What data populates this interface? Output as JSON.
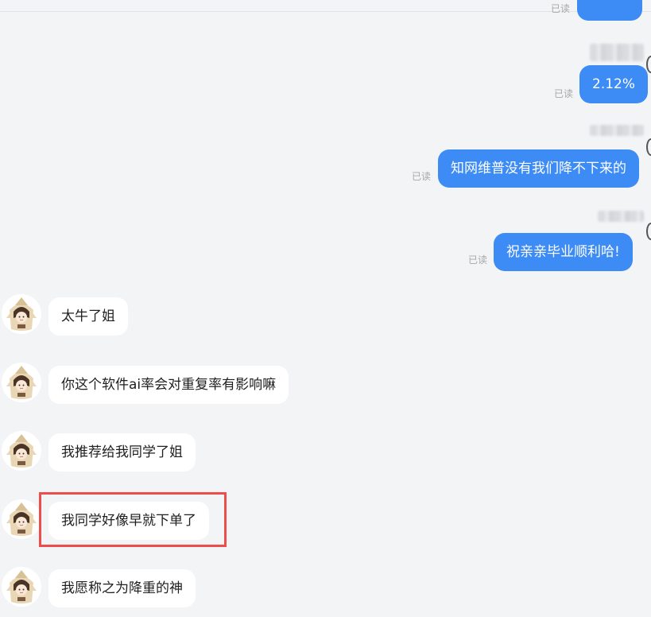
{
  "conversation": {
    "read_label": "已读",
    "outgoing": [
      {
        "text": "2.12%"
      },
      {
        "text": "知网维普没有我们降不下来的"
      },
      {
        "text": "祝亲亲毕业顺利哈!"
      }
    ],
    "incoming": [
      {
        "text": "太牛了姐"
      },
      {
        "text": "你这个软件ai率会对重复率有影响嘛"
      },
      {
        "text": "我推荐给我同学了姐"
      },
      {
        "text": "我同学好像早就下单了",
        "highlighted": true
      },
      {
        "text": "我愿称之为降重的神"
      }
    ]
  },
  "colors": {
    "outgoing_bubble": "#3d8bf5",
    "incoming_bubble": "#ffffff",
    "background": "#f3f4f6",
    "highlight": "#ef4c4c",
    "read_text": "#a8a8a8"
  },
  "icons": {
    "avatar": "cartoon-girl-avatar-icon"
  }
}
